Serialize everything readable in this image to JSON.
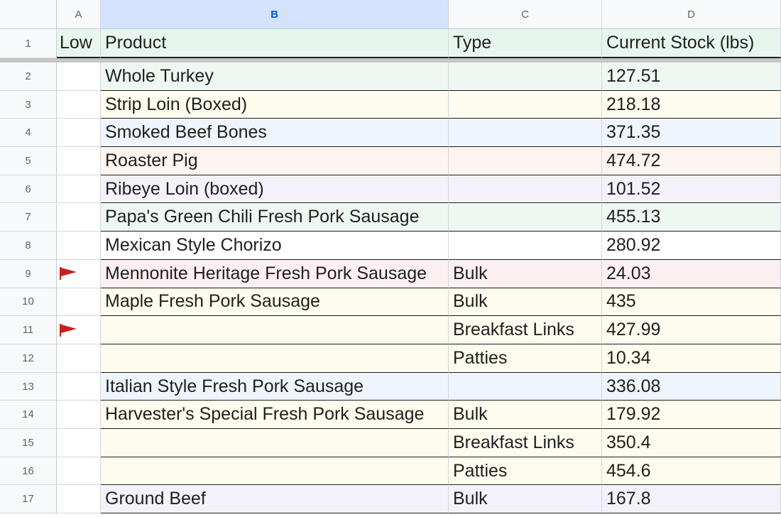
{
  "columns": [
    "A",
    "B",
    "C",
    "D"
  ],
  "header": {
    "row_number": "1",
    "low": "Low",
    "product": "Product",
    "type": "Type",
    "stock": "Current Stock (lbs)"
  },
  "rows": [
    {
      "n": "2",
      "flag": false,
      "product": "Whole Turkey",
      "type": "",
      "stock": "127.51",
      "color": "#eef8f3"
    },
    {
      "n": "3",
      "flag": false,
      "product": "Strip Loin (Boxed)",
      "type": "",
      "stock": "218.18",
      "color": "#fdfcee"
    },
    {
      "n": "4",
      "flag": false,
      "product": "Smoked Beef Bones",
      "type": "",
      "stock": "371.35",
      "color": "#eef5fc"
    },
    {
      "n": "5",
      "flag": false,
      "product": "Roaster Pig",
      "type": "",
      "stock": "474.72",
      "color": "#fdf4ef"
    },
    {
      "n": "6",
      "flag": false,
      "product": "Ribeye Loin (boxed)",
      "type": "",
      "stock": "101.52",
      "color": "#f3f2fb"
    },
    {
      "n": "7",
      "flag": false,
      "product": "Papa's Green Chili Fresh Pork Sausage",
      "type": "",
      "stock": "455.13",
      "color": "#eef8f3"
    },
    {
      "n": "8",
      "flag": false,
      "product": "Mexican Style Chorizo",
      "type": "",
      "stock": "280.92",
      "color": "#ffffff"
    },
    {
      "n": "9",
      "flag": true,
      "product": "Mennonite Heritage Fresh Pork Sausage",
      "type": "Bulk",
      "stock": "24.03",
      "color": "#fbeff2"
    },
    {
      "n": "10",
      "flag": false,
      "product": "Maple Fresh Pork Sausage",
      "type": "Bulk",
      "stock": "435",
      "color": "#fdfcee"
    },
    {
      "n": "11",
      "flag": true,
      "product": "",
      "type": "Breakfast Links",
      "stock": "427.99",
      "color": "#fdfcee"
    },
    {
      "n": "12",
      "flag": false,
      "product": "",
      "type": "Patties",
      "stock": "10.34",
      "color": "#fdfcee"
    },
    {
      "n": "13",
      "flag": false,
      "product": "Italian Style Fresh Pork Sausage",
      "type": "",
      "stock": "336.08",
      "color": "#eef5fc"
    },
    {
      "n": "14",
      "flag": false,
      "product": "Harvester's Special Fresh Pork Sausage",
      "type": "Bulk",
      "stock": "179.92",
      "color": "#fdfcee"
    },
    {
      "n": "15",
      "flag": false,
      "product": "",
      "type": "Breakfast Links",
      "stock": "350.4",
      "color": "#fdfcee"
    },
    {
      "n": "16",
      "flag": false,
      "product": "",
      "type": "Patties",
      "stock": "454.6",
      "color": "#fdfcee"
    },
    {
      "n": "17",
      "flag": false,
      "product": "Ground Beef",
      "type": "Bulk",
      "stock": "167.8",
      "color": "#f3f2fb"
    }
  ],
  "icons": {
    "flag": "red-flag-icon"
  },
  "colors": {
    "flag": "#c5221f",
    "header_bg": "#e6f6ee",
    "selected_col": "#d3e3fd"
  }
}
